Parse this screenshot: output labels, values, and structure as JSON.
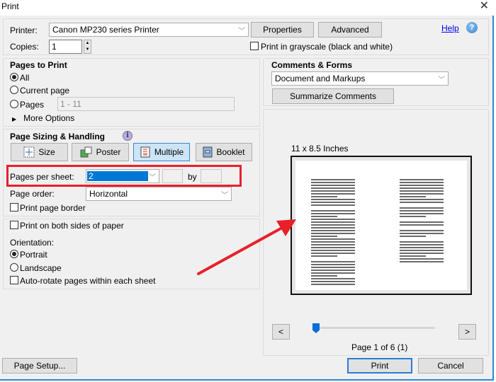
{
  "window": {
    "title": "Print",
    "close_glyph": "✕"
  },
  "printer": {
    "label": "Printer:",
    "value": "Canon MP230 series Printer",
    "properties_button": "Properties",
    "advanced_button": "Advanced",
    "help_link": "Help",
    "help_icon": "?"
  },
  "copies": {
    "label": "Copies:",
    "value": "1"
  },
  "grayscale": {
    "label": "Print in grayscale (black and white)",
    "checked": false
  },
  "pages_to_print": {
    "heading": "Pages to Print",
    "options": [
      {
        "label": "All",
        "selected": true
      },
      {
        "label": "Current page",
        "selected": false
      },
      {
        "label": "Pages",
        "selected": false
      }
    ],
    "pages_range_placeholder": "1 - 11",
    "more_options": "More Options"
  },
  "comments_forms": {
    "heading": "Comments & Forms",
    "value": "Document and Markups",
    "summarize_button": "Summarize Comments"
  },
  "page_sizing": {
    "heading": "Page Sizing & Handling",
    "info_icon": "i",
    "modes": [
      {
        "label": "Size",
        "icon": "size-icon",
        "active": false
      },
      {
        "label": "Poster",
        "icon": "poster-icon",
        "active": false
      },
      {
        "label": "Multiple",
        "icon": "multiple-icon",
        "active": true
      },
      {
        "label": "Booklet",
        "icon": "booklet-icon",
        "active": false
      }
    ],
    "pages_per_sheet_label": "Pages per sheet:",
    "pages_per_sheet_value": "2",
    "by_label": "by",
    "page_order_label": "Page order:",
    "page_order_value": "Horizontal",
    "print_page_border": {
      "label": "Print page border",
      "checked": false
    }
  },
  "duplex": {
    "label": "Print on both sides of paper",
    "checked": false
  },
  "orientation": {
    "label": "Orientation:",
    "options": [
      {
        "label": "Portrait",
        "selected": true
      },
      {
        "label": "Landscape",
        "selected": false
      }
    ],
    "auto_rotate": {
      "label": "Auto-rotate pages within each sheet",
      "checked": false
    }
  },
  "preview": {
    "size_label": "11 x 8.5 Inches",
    "prev_button": "<",
    "next_button": ">",
    "page_status": "Page 1 of 6 (1)",
    "slider_position": "1 of 6"
  },
  "footer": {
    "page_setup_button": "Page Setup...",
    "print_button": "Print",
    "cancel_button": "Cancel"
  },
  "annotation": {
    "color": "#e8202a"
  }
}
